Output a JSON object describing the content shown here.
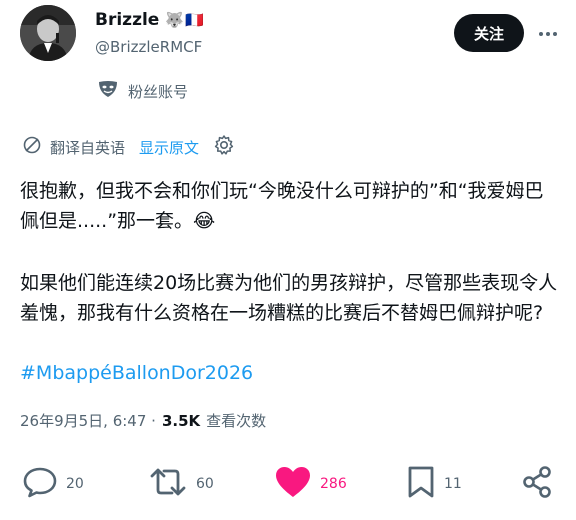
{
  "header": {
    "display_name": "Brizzle",
    "badges": "🐺🇫🇷",
    "handle": "@BrizzleRMCF",
    "follow_label": "关注"
  },
  "fan_account": {
    "label": "粉丝账号",
    "icon": "mask-icon"
  },
  "translation": {
    "label": "翻译自英语",
    "show_original": "显示原文",
    "colors": {
      "link": "#1d9bf0"
    }
  },
  "post": {
    "paragraph1": "很抱歉，但我不会和你们玩“今晚没什么可辩护的”和“我爱姆巴佩但是.....”那一套。😂",
    "paragraph2": "如果他们能连续20场比赛为他们的男孩辩护，尽管那些表现令人羞愧，那我有什么资格在一场糟糕的比赛后不替姆巴佩辩护呢?",
    "hashtag": "#MbappéBallonDor2026"
  },
  "meta": {
    "timestamp": "26年9月5日, 6:47 ·",
    "views": "3.5K",
    "views_label": "查看次数"
  },
  "actions": {
    "replies": "20",
    "retweets": "60",
    "likes": "286",
    "bookmarks": "11",
    "like_color": "#f91880"
  }
}
